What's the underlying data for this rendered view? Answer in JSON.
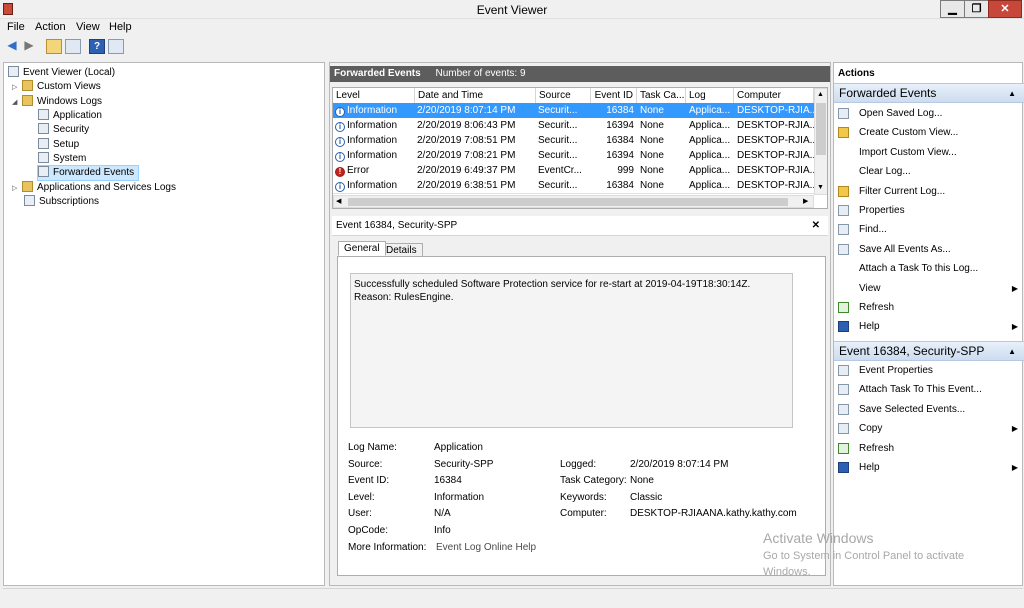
{
  "window": {
    "title": "Event Viewer",
    "min": "▁",
    "max": "❐",
    "close": "✕"
  },
  "menu": [
    "File",
    "Action",
    "View",
    "Help"
  ],
  "toolbar": {
    "back": "◀",
    "forward": "▶"
  },
  "tree": {
    "root": "Event Viewer (Local)",
    "custom_views": "Custom Views",
    "windows_logs": "Windows Logs",
    "application": "Application",
    "security": "Security",
    "setup": "Setup",
    "system": "System",
    "forwarded_events": "Forwarded Events",
    "apps_services": "Applications and Services Logs",
    "subscriptions": "Subscriptions"
  },
  "events_panel": {
    "title": "Forwarded Events",
    "count_text": "Number of events: 9",
    "columns": [
      "Level",
      "Date and Time",
      "Source",
      "Event ID",
      "Task Ca...",
      "Log",
      "Computer"
    ],
    "rows": [
      {
        "level": "Information",
        "date": "2/20/2019 8:07:14 PM",
        "source": "Securit...",
        "id": "16384",
        "task": "None",
        "log": "Applica...",
        "computer": "DESKTOP-RJIA..."
      },
      {
        "level": "Information",
        "date": "2/20/2019 8:06:43 PM",
        "source": "Securit...",
        "id": "16394",
        "task": "None",
        "log": "Applica...",
        "computer": "DESKTOP-RJIA..."
      },
      {
        "level": "Information",
        "date": "2/20/2019 7:08:51 PM",
        "source": "Securit...",
        "id": "16384",
        "task": "None",
        "log": "Applica...",
        "computer": "DESKTOP-RJIA..."
      },
      {
        "level": "Information",
        "date": "2/20/2019 7:08:21 PM",
        "source": "Securit...",
        "id": "16394",
        "task": "None",
        "log": "Applica...",
        "computer": "DESKTOP-RJIA..."
      },
      {
        "level": "Error",
        "date": "2/20/2019 6:49:37 PM",
        "source": "EventCr...",
        "id": "999",
        "task": "None",
        "log": "Applica...",
        "computer": "DESKTOP-RJIA..."
      },
      {
        "level": "Information",
        "date": "2/20/2019 6:38:51 PM",
        "source": "Securit...",
        "id": "16384",
        "task": "None",
        "log": "Applica...",
        "computer": "DESKTOP-RJIA..."
      }
    ]
  },
  "detail": {
    "title": "Event 16384, Security-SPP",
    "close": "✕",
    "tab_general": "General",
    "tab_details": "Details",
    "message": "Successfully scheduled Software Protection service for re-start at 2019-04-19T18:30:14Z. Reason: RulesEngine.",
    "log_name_label": "Log Name:",
    "log_name": "Application",
    "source_label": "Source:",
    "source": "Security-SPP",
    "logged_label": "Logged:",
    "logged": "2/20/2019 8:07:14 PM",
    "event_id_label": "Event ID:",
    "event_id": "16384",
    "task_category_label": "Task Category:",
    "task_category": "None",
    "level_label": "Level:",
    "level": "Information",
    "keywords_label": "Keywords:",
    "keywords": "Classic",
    "user_label": "User:",
    "user": "N/A",
    "computer_label": "Computer:",
    "computer": "DESKTOP-RJIAANA.kathy.kathy.com",
    "opcode_label": "OpCode:",
    "opcode": "Info",
    "more_info_label": "More Information:",
    "more_info_link": "Event Log Online Help"
  },
  "actions": {
    "title": "Actions",
    "group1": "Forwarded Events",
    "items1": [
      "Open Saved Log...",
      "Create Custom View...",
      "Import Custom View...",
      "Clear Log...",
      "Filter Current Log...",
      "Properties",
      "Find...",
      "Save All Events As...",
      "Attach a Task To this Log...",
      "View",
      "Refresh",
      "Help"
    ],
    "group2": "Event 16384, Security-SPP",
    "items2": [
      "Event Properties",
      "Attach Task To This Event...",
      "Save Selected Events...",
      "Copy",
      "Refresh",
      "Help"
    ]
  },
  "watermark": {
    "line1": "Activate Windows",
    "line2": "Go to System in Control Panel to activate",
    "line3": "Windows."
  }
}
